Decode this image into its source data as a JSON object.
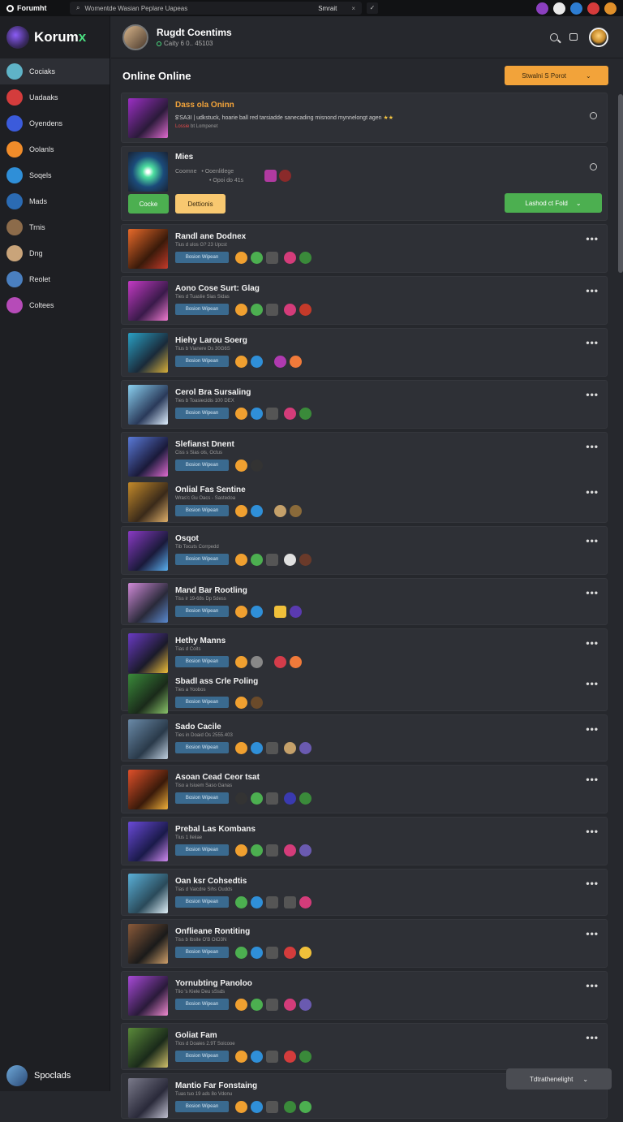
{
  "topbar": {
    "app_name": "Forumht",
    "search_text": "Womentde Wasian Peplare Uapeas",
    "select_label": "Smrait",
    "clear": "×",
    "check": "✓"
  },
  "sidebar": {
    "brand": "Korumx",
    "brand_main": "Korum",
    "brand_x": "x",
    "items": [
      {
        "label": "Cociaks",
        "color": "#5fb3c7"
      },
      {
        "label": "Uadaaks",
        "color": "#d43c3c"
      },
      {
        "label": "Oyendens",
        "color": "#3b5bdb"
      },
      {
        "label": "Oolanls",
        "color": "#f08c2a"
      },
      {
        "label": "Soqels",
        "color": "#2f8fd8"
      },
      {
        "label": "Mads",
        "color": "#2b6bb3"
      },
      {
        "label": "Trnis",
        "color": "#8c6b4a"
      },
      {
        "label": "Dng",
        "color": "#c9a47a"
      },
      {
        "label": "Reolet",
        "color": "#4a7fbf"
      },
      {
        "label": "Coltees",
        "color": "#b64bb8"
      }
    ],
    "footer_label": "Spoclads"
  },
  "header": {
    "title": "Rugdt Coentims",
    "subtitle": "Caity 6 0.. 45103"
  },
  "section": {
    "title": "Online Online",
    "sort_label": "Stwalni S Porot",
    "sort_chevron": "⌄"
  },
  "featured": [
    {
      "title": "Dass ola Oninn",
      "line1": "$'SA3I | udkstuck, hoarie ball red tarsiadde sanecading misnond mynnelongt agen",
      "stars": "★★",
      "line2_hot": "Lossie",
      "line2": "bt Lompenet"
    },
    {
      "title": "Mies",
      "line1_a": "Coomne",
      "line1_b": "• Ooenlitlege",
      "line2": "• Opoi do 41s",
      "btn_green": "Cocke",
      "btn_yellow": "Dettionis",
      "btn_right": "Lashod ct Fold"
    }
  ],
  "chip_label": "Bosion Wipean",
  "posts": [
    {
      "title": "Randl ane Dodnex",
      "sub": "Tius d ulos G? 23 Upcst"
    },
    {
      "title": "Aono Cose Surt: Glag",
      "sub": "Ties d Tuaslie Sias Sidas"
    },
    {
      "title": "Hiehy Larou Soerg",
      "sub": "Tius b Vianere Ds 30G6S"
    },
    {
      "title": "Cerol Bra Sursaling",
      "sub": "Ties b Toasiecidis 100 DEX"
    },
    {
      "title": "Slefianst Dnent",
      "sub": "Ciss s Sias ols, Octus"
    },
    {
      "title": "Onlial Fas Sentine",
      "sub": "Wras'c Gu Oacs - Sastedoa"
    },
    {
      "title": "Osqot",
      "sub": "Tib Tocuts Corrpedd"
    },
    {
      "title": "Mand Bar Rootling",
      "sub": "Tiss ir 19-68s Dp 5dess"
    },
    {
      "title": "Hethy Manns",
      "sub": "Tias d Coits"
    },
    {
      "title": "Sbadl ass Crle Poling",
      "sub": "Ties a Yoobos"
    },
    {
      "title": "Sado Cacile",
      "sub": "Ties in Doaid Os 2555.403"
    },
    {
      "title": "Asoan Cead Ceor tsat",
      "sub": "Tiso a Isiuem Saso Ganas"
    },
    {
      "title": "Prebal Las Kombans",
      "sub": "Tius 1 lleiiae"
    },
    {
      "title": "Oan ksr Cohsedtis",
      "sub": "Tias d Vaicdre Sihs Oudds"
    },
    {
      "title": "Onflieane Rontiting",
      "sub": "Tiss b Ibsite O'B OiO3N"
    },
    {
      "title": "Yornubting Panoloo",
      "sub": "Tlio 's Kiele Deu sSsds"
    },
    {
      "title": "Goliat Fam",
      "sub": "Tlos d Doaies 2.9T Soicooe"
    },
    {
      "title": "Mantio Far Fonstaing",
      "sub": "Tuas tuo 19 ads 8o Vdonu"
    }
  ],
  "more_label": "•••",
  "bottom_pill": {
    "label": "Tdtrathenelight",
    "chevron": "⌄"
  },
  "colors": {
    "accent_orange": "#f2a33a",
    "accent_green": "#4caf50",
    "chip_blue": "#3a6a8f",
    "background": "#26282d"
  }
}
